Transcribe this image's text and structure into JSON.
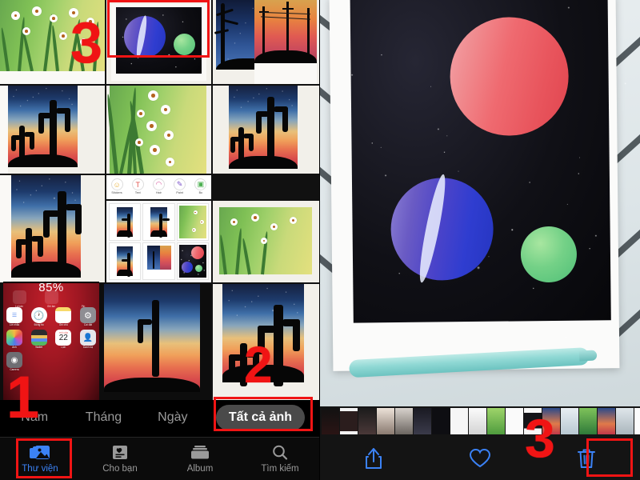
{
  "app": {
    "name": "Photos",
    "platform": "iOS",
    "language": "vi"
  },
  "left_panel": {
    "name": "photos-library-screen",
    "segmented_control": {
      "name": "photos-view-segmented-control",
      "options": [
        {
          "label": "Năm",
          "selected": false
        },
        {
          "label": "Tháng",
          "selected": false
        },
        {
          "label": "Ngày",
          "selected": false
        },
        {
          "label": "Tất cả ảnh",
          "selected": true
        }
      ],
      "selected_label": "Tất cả ảnh"
    },
    "tab_bar": {
      "name": "photos-tab-bar",
      "tabs": [
        {
          "label": "Thư viện",
          "icon": "photos-library-icon",
          "selected": true
        },
        {
          "label": "Cho bạn",
          "icon": "for-you-icon",
          "selected": false
        },
        {
          "label": "Album",
          "icon": "albums-icon",
          "selected": false
        },
        {
          "label": "Tìm kiếm",
          "icon": "search-icon",
          "selected": false
        }
      ],
      "selected_label": "Thư viện",
      "selected_color": "#3b82f6"
    },
    "photo_grid": {
      "name": "photo-grid",
      "cells": [
        {
          "kind": "daisy-meadow",
          "caption": "watercolor daisy meadow painting"
        },
        {
          "kind": "space-planets",
          "caption": "watercolor space painting with blue and green planets",
          "selected": true
        },
        {
          "kind": "night-tree",
          "caption": "watercolor night sky with tree silhouette"
        },
        {
          "kind": "cactus-sunset",
          "caption": "watercolor cactus sunset painting"
        },
        {
          "kind": "daisy-meadow-2",
          "caption": "watercolor daisies on green field"
        },
        {
          "kind": "cactus-sunset-2",
          "caption": "watercolor cactus at sunset"
        },
        {
          "kind": "cactus-sunset-3",
          "caption": "watercolor cactus sunset painting tall"
        },
        {
          "kind": "editor-toolbar",
          "caption": "screenshot of photo editor tool row"
        },
        {
          "kind": "daisy-meadow-3",
          "caption": "watercolor daisies screenshot"
        },
        {
          "kind": "ios-home",
          "caption": "iOS home screen screenshot"
        },
        {
          "kind": "screenshot-gallery",
          "caption": "screenshot of artwork gallery grid"
        }
      ]
    },
    "editor_toolbar_thumbnail": {
      "name": "editor-tools-row",
      "tools": [
        {
          "label": "Stickers",
          "icon": "smiley-icon"
        },
        {
          "label": "Text",
          "icon": "text-icon"
        },
        {
          "label": "Hair",
          "icon": "hair-icon"
        },
        {
          "label": "Paint",
          "icon": "paint-icon"
        },
        {
          "label": "Bo",
          "icon": "border-icon"
        }
      ]
    },
    "ios_home_thumbnail": {
      "name": "ios-home-screen-thumbnail",
      "battery_text": "85%",
      "widgets": [
        {
          "label": "La bàn",
          "icon": "compass-icon"
        },
        {
          "label": "Ghi âm",
          "icon": "voice-memos-icon"
        },
        {
          "label": "Pin",
          "icon": "battery-icon"
        }
      ],
      "apps_row_1": [
        {
          "label": "Lời nhắc",
          "icon": "reminders-icon"
        },
        {
          "label": "Đồng hồ",
          "icon": "clock-icon"
        },
        {
          "label": "Ghi chú",
          "icon": "notes-icon"
        },
        {
          "label": "Cài đặt",
          "icon": "settings-icon"
        }
      ],
      "apps_row_2": [
        {
          "label": "Ảnh",
          "icon": "photos-icon"
        },
        {
          "label": "Wallet",
          "icon": "wallet-icon"
        },
        {
          "label": "Lịch",
          "icon": "calendar-icon",
          "badge": "22",
          "sub": "THỨ NĂM"
        },
        {
          "label": "Danh bạ",
          "icon": "contacts-icon"
        }
      ],
      "apps_row_3": [
        {
          "label": "Camera",
          "icon": "camera-icon"
        }
      ]
    }
  },
  "right_panel": {
    "name": "photo-detail-screen",
    "photo": {
      "name": "selected-photo",
      "caption": "watercolor space painting: red planet, striped blue planet, green planet on black starry sky"
    },
    "thumbnail_strip": {
      "name": "photo-filmstrip",
      "count": 17
    },
    "action_bar": {
      "name": "photo-action-bar",
      "actions": [
        {
          "label": "Chia sẻ",
          "icon": "share-icon",
          "name": "share-button"
        },
        {
          "label": "Yêu thích",
          "icon": "heart-icon",
          "name": "favorite-button"
        },
        {
          "label": "Xóa",
          "icon": "trash-icon",
          "name": "delete-button",
          "highlighted": true
        }
      ],
      "icon_color": "#3b82f6"
    }
  },
  "annotations": {
    "color": "#f01414",
    "steps": [
      {
        "number": "1",
        "target": "Thư viện tab"
      },
      {
        "number": "2",
        "target": "Tất cả ảnh segment"
      },
      {
        "number": "3",
        "target": "selected photo in grid"
      },
      {
        "number": "3",
        "target": "trash / delete button"
      }
    ]
  }
}
